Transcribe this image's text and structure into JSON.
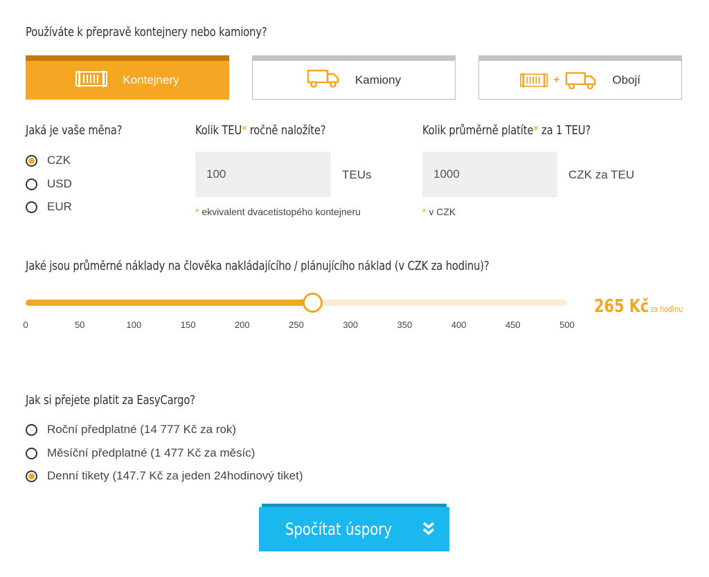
{
  "transport": {
    "question": "Používáte k přepravě kontejnery nebo kamiony?",
    "options": [
      {
        "label": "Kontejnery",
        "icon": "container-icon",
        "active": true
      },
      {
        "label": "Kamiony",
        "icon": "truck-icon",
        "active": false
      },
      {
        "label": "Obojí",
        "icon": "container-plus-truck-icon",
        "plus": "+",
        "active": false
      }
    ]
  },
  "currency": {
    "question": "Jaká je vaše měna?",
    "options": [
      "CZK",
      "USD",
      "EUR"
    ],
    "selected": "CZK"
  },
  "teu": {
    "question_main": "Kolik TEU",
    "star": "*",
    "question_rest": " ročně naložíte?",
    "value": "100",
    "unit": "TEUs",
    "note": "ekvivalent dvacetistopého kontejneru"
  },
  "price": {
    "question_main": "Kolik průměrně platíte",
    "star": "*",
    "question_rest": " za 1 TEU?",
    "value": "1000",
    "unit": "CZK za TEU",
    "note": "v CZK"
  },
  "labor": {
    "question": "Jaké jsou průměrné náklady na člověka nakládajícího / plánujícího náklad (v CZK za hodinu)?",
    "min": 0,
    "max": 500,
    "value": 265,
    "ticks": [
      "0",
      "50",
      "100",
      "150",
      "200",
      "250",
      "300",
      "350",
      "400",
      "450",
      "500"
    ],
    "value_label": "265 Kč",
    "value_unit": "za hodinu"
  },
  "payment": {
    "question": "Jak si přejete platit za EasyCargo?",
    "options": [
      "Roční předplatné (14 777 Kč za rok)",
      "Měsíční předplatné (1 477 Kč za měsíc)",
      "Denní tikety (147.7 Kč za jeden 24hodinový tiket)"
    ],
    "selected_index": 2
  },
  "submit": {
    "label": "Spočítat úspory",
    "icon": "double-chevron-down-icon"
  },
  "colors": {
    "accent": "#f5a623",
    "accent_dark": "#c9780a",
    "button": "#1ab8ee",
    "button_dark": "#1496c5",
    "input_bg": "#efefef"
  }
}
